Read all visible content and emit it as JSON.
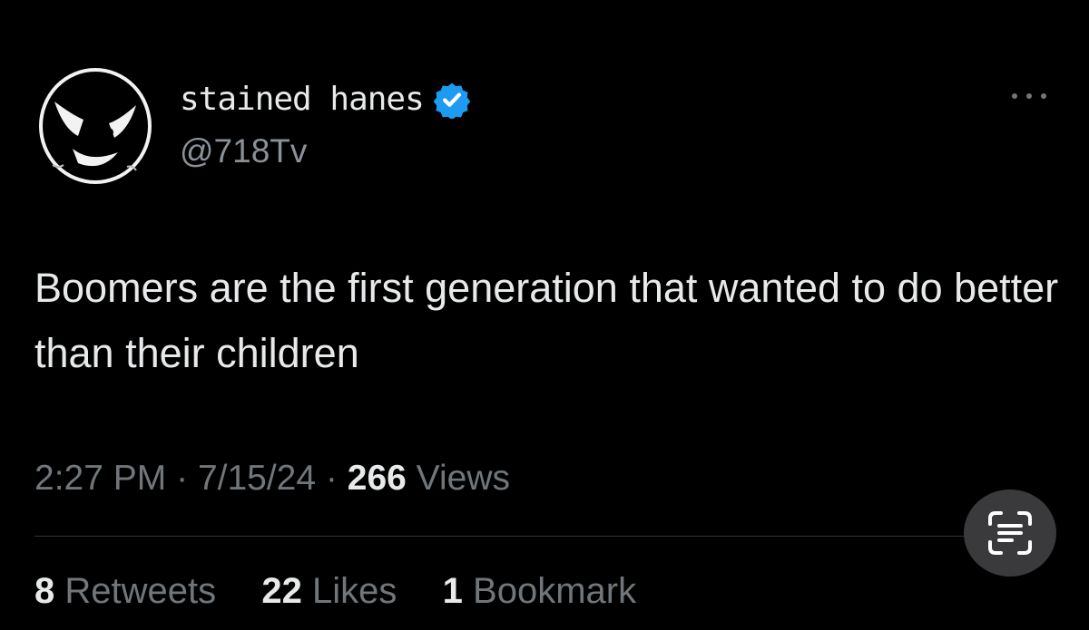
{
  "author": {
    "display_name": "stained hanes",
    "handle": "@718Tv",
    "verified_color": "#1d9bf0"
  },
  "tweet": {
    "text": "Boomers are the first generation that wanted to do better than their children"
  },
  "meta": {
    "time": "2:27 PM",
    "separator": "·",
    "date": "7/15/24",
    "views_count": "266",
    "views_label": "Views"
  },
  "stats": {
    "retweets_count": "8",
    "retweets_label": "Retweets",
    "likes_count": "22",
    "likes_label": "Likes",
    "bookmarks_count": "1",
    "bookmarks_label": "Bookmark"
  },
  "icons": {
    "more": "more-horizontal-icon",
    "verified": "verified-badge-icon",
    "scan": "live-text-scan-icon"
  }
}
